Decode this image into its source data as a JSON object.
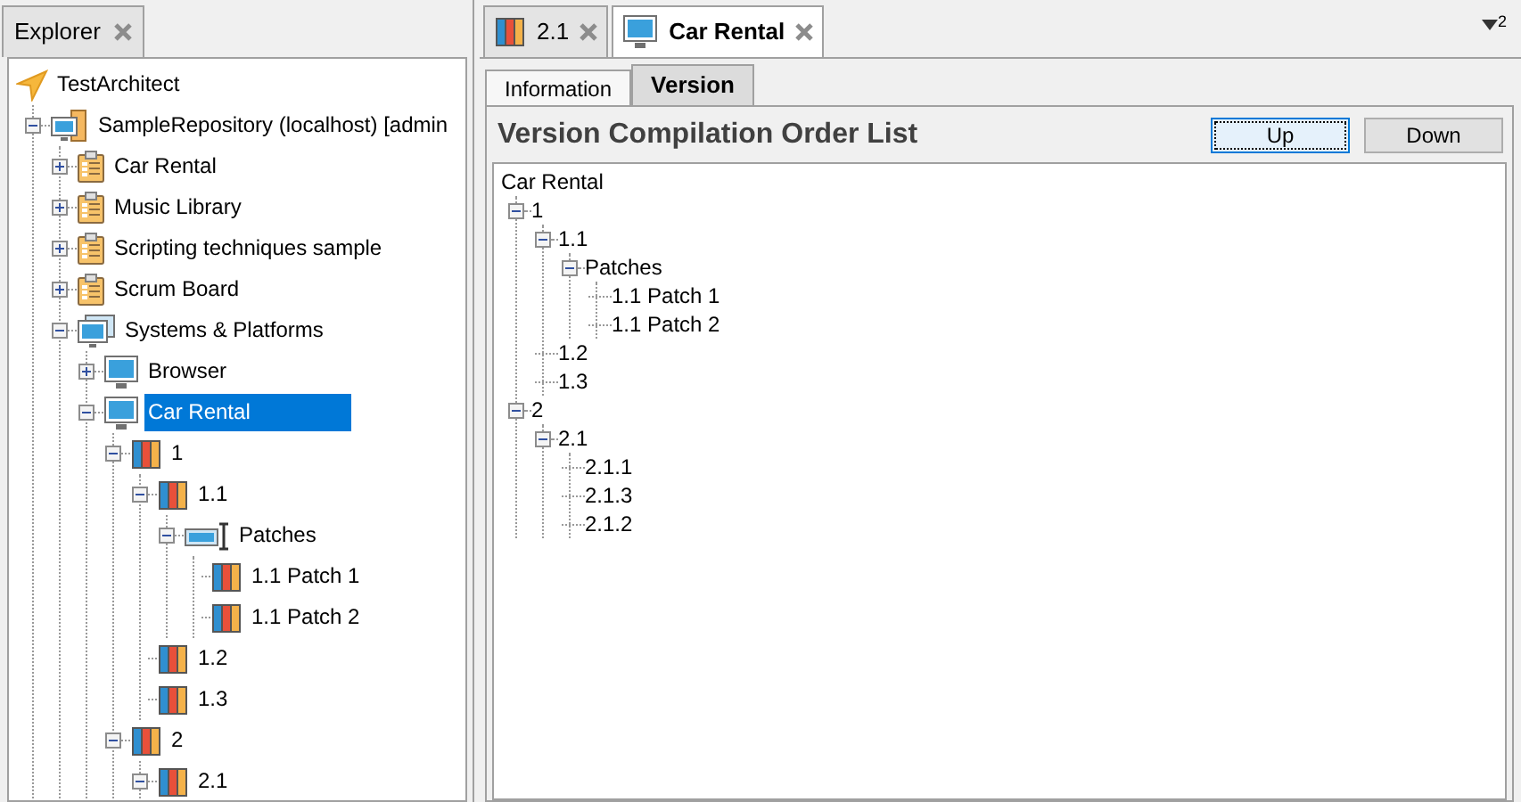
{
  "explorer": {
    "title": "Explorer",
    "tree": [
      {
        "label": "TestArchitect",
        "kind": "architect",
        "selected": false,
        "children": [
          {
            "label": "SampleRepository (localhost) [admin",
            "kind": "repository",
            "selected": false,
            "expanded": true,
            "children": [
              {
                "label": "Car Rental",
                "kind": "project",
                "selected": false,
                "expanded": false
              },
              {
                "label": "Music Library",
                "kind": "project",
                "selected": false,
                "expanded": false
              },
              {
                "label": "Scripting techniques sample",
                "kind": "project",
                "selected": false,
                "expanded": false
              },
              {
                "label": "Scrum Board",
                "kind": "project",
                "selected": false,
                "expanded": false
              },
              {
                "label": "Systems & Platforms",
                "kind": "systems",
                "selected": false,
                "expanded": true,
                "children": [
                  {
                    "label": "Browser",
                    "kind": "system",
                    "selected": false,
                    "expanded": false
                  },
                  {
                    "label": "Car Rental",
                    "kind": "system",
                    "selected": true,
                    "expanded": true,
                    "children": [
                      {
                        "label": "1",
                        "kind": "version",
                        "selected": false,
                        "expanded": true,
                        "children": [
                          {
                            "label": "1.1",
                            "kind": "version",
                            "selected": false,
                            "expanded": true,
                            "children": [
                              {
                                "label": "Patches",
                                "kind": "patches",
                                "selected": false,
                                "expanded": true,
                                "children": [
                                  {
                                    "label": "1.1 Patch 1",
                                    "kind": "version",
                                    "selected": false
                                  },
                                  {
                                    "label": "1.1 Patch 2",
                                    "kind": "version",
                                    "selected": false
                                  }
                                ]
                              }
                            ]
                          },
                          {
                            "label": "1.2",
                            "kind": "version",
                            "selected": false
                          },
                          {
                            "label": "1.3",
                            "kind": "version",
                            "selected": false
                          }
                        ]
                      },
                      {
                        "label": "2",
                        "kind": "version",
                        "selected": false,
                        "expanded": true,
                        "children": [
                          {
                            "label": "2.1",
                            "kind": "version",
                            "selected": false,
                            "expanded": true
                          }
                        ]
                      }
                    ]
                  }
                ]
              }
            ]
          }
        ]
      }
    ]
  },
  "editor_tabs": [
    {
      "label": "2.1",
      "kind": "version",
      "selected": false
    },
    {
      "label": "Car Rental",
      "kind": "system",
      "selected": true
    }
  ],
  "overflow_count": "2",
  "sub_tabs": [
    {
      "label": "Information",
      "selected": false
    },
    {
      "label": "Version",
      "selected": true
    }
  ],
  "version_panel": {
    "title": "Version Compilation Order List",
    "buttons": [
      {
        "label": "Up",
        "focused": true
      },
      {
        "label": "Down",
        "focused": false
      }
    ],
    "tree": [
      {
        "label": "Car Rental",
        "children": [
          {
            "label": "1",
            "expanded": true,
            "children": [
              {
                "label": "1.1",
                "expanded": true,
                "children": [
                  {
                    "label": "Patches",
                    "expanded": true,
                    "children": [
                      {
                        "label": "1.1 Patch 1"
                      },
                      {
                        "label": "1.1 Patch 2"
                      }
                    ]
                  }
                ]
              },
              {
                "label": "1.2"
              },
              {
                "label": "1.3"
              }
            ]
          },
          {
            "label": "2",
            "expanded": true,
            "children": [
              {
                "label": "2.1",
                "expanded": true,
                "children": [
                  {
                    "label": "2.1.1"
                  },
                  {
                    "label": "2.1.3"
                  },
                  {
                    "label": "2.1.2"
                  }
                ]
              }
            ]
          }
        ]
      }
    ]
  }
}
